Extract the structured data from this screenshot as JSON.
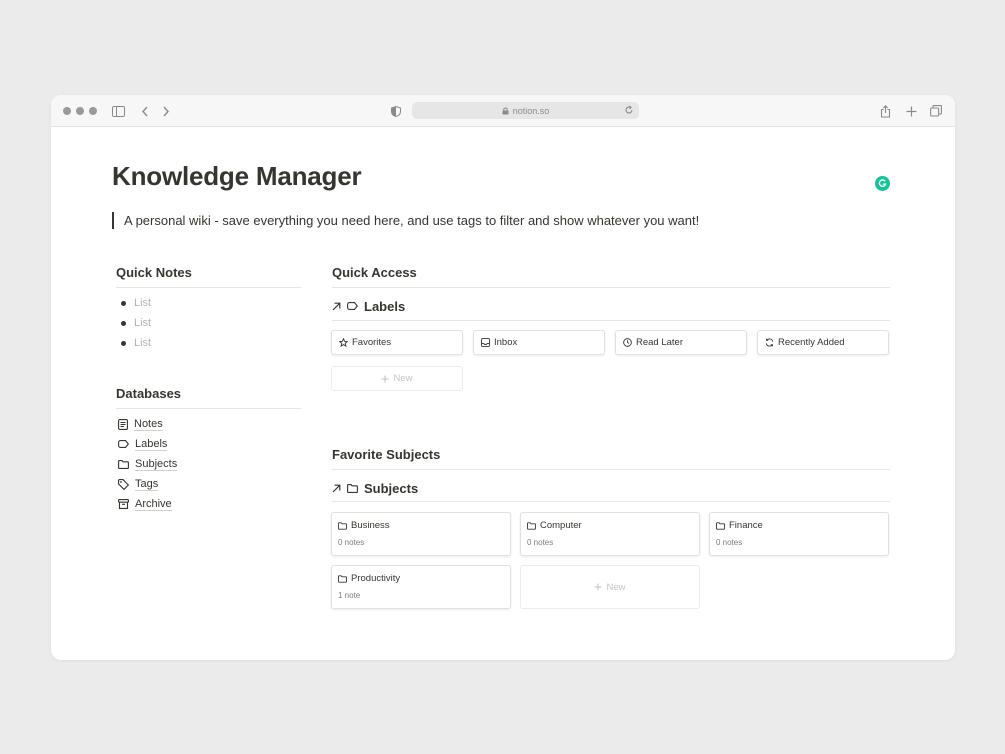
{
  "browser": {
    "url": "notion.so"
  },
  "page": {
    "title": "Knowledge Manager",
    "description": "A personal wiki - save everything you need here, and use tags to filter and show whatever you want!"
  },
  "quick_notes": {
    "heading": "Quick Notes",
    "items": [
      "List",
      "List",
      "List"
    ]
  },
  "databases": {
    "heading": "Databases",
    "items": [
      {
        "label": "Notes",
        "icon": "notes-icon"
      },
      {
        "label": "Labels",
        "icon": "tag-outline-icon"
      },
      {
        "label": "Subjects",
        "icon": "folder-icon"
      },
      {
        "label": "Tags",
        "icon": "tag-icon"
      },
      {
        "label": "Archive",
        "icon": "archive-icon"
      }
    ]
  },
  "quick_access": {
    "heading": "Quick Access",
    "view_title": "Labels",
    "cards": [
      {
        "label": "Favorites",
        "icon": "star-icon"
      },
      {
        "label": "Inbox",
        "icon": "inbox-icon"
      },
      {
        "label": "Read Later",
        "icon": "clock-icon"
      },
      {
        "label": "Recently Added",
        "icon": "refresh-icon"
      }
    ],
    "new_label": "New"
  },
  "favorite_subjects": {
    "heading": "Favorite Subjects",
    "view_title": "Subjects",
    "cards": [
      {
        "label": "Business",
        "count": "0 notes"
      },
      {
        "label": "Computer",
        "count": "0 notes"
      },
      {
        "label": "Finance",
        "count": "0 notes"
      },
      {
        "label": "Productivity",
        "count": "1 note"
      }
    ],
    "new_label": "New"
  },
  "colors": {
    "text": "#37352f",
    "grammarly": "#15c39a",
    "background": "#ebebeb"
  }
}
